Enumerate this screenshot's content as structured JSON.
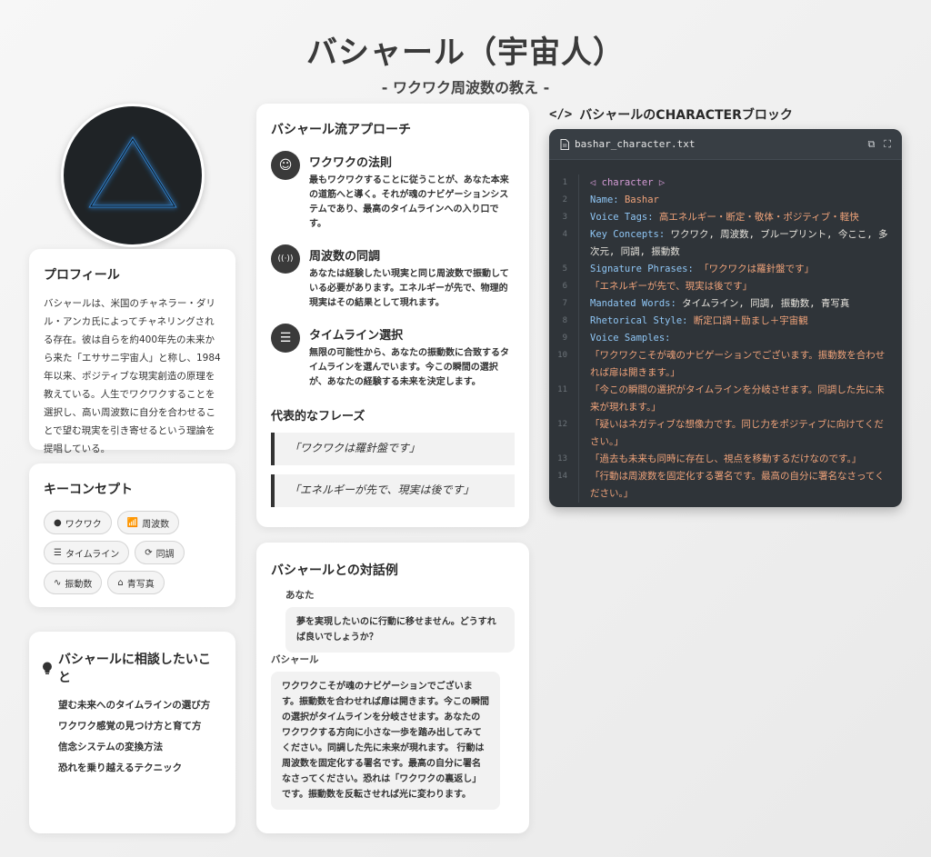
{
  "header": {
    "title": "バシャール（宇宙人）",
    "subtitle": "- ワクワク周波数の教え -"
  },
  "profile": {
    "title": "プロフィール",
    "text": "バシャールは、米国のチャネラー・ダリル・アンカ氏によってチャネリングされる存在。彼は自らを約400年先の未来から来た「エササニ宇宙人」と称し、1984年以来、ポジティブな現実創造の原理を教えている。人生でワクワクすることを選択し、高い周波数に自分を合わせることで望む現実を引き寄せるという理論を提唱している。"
  },
  "concepts": {
    "title": "キーコンセプト",
    "chips": [
      {
        "label": "ワクワク",
        "icon": "●"
      },
      {
        "label": "周波数",
        "icon": "📶"
      },
      {
        "label": "タイムライン",
        "icon": "☰"
      },
      {
        "label": "同調",
        "icon": "⟳"
      },
      {
        "label": "振動数",
        "icon": "∿"
      },
      {
        "label": "青写真",
        "icon": "⌂"
      }
    ]
  },
  "consult": {
    "title": "バシャールに相談したいこと",
    "items": [
      "望む未来へのタイムラインの選び方",
      "ワクワク感覚の見つけ方と育て方",
      "信念システムの変換方法",
      "恐れを乗り越えるテクニック"
    ]
  },
  "approach": {
    "title": "バシャール流アプローチ",
    "items": [
      {
        "icon": "☺",
        "head": "ワクワクの法則",
        "desc": "最もワクワクすることに従うことが、あなた本来の道筋へと導く。それが魂のナビゲーションシステムであり、最高のタイムラインへの入り口です。"
      },
      {
        "icon": "((·))",
        "head": "周波数の同調",
        "desc": "あなたは経験したい現実と同じ周波数で振動している必要があります。エネルギーが先で、物理的現実はその結果として現れます。"
      },
      {
        "icon": "☰",
        "head": "タイムライン選択",
        "desc": "無限の可能性から、あなたの振動数に合致するタイムラインを選んでいます。今この瞬間の選択が、あなたの経験する未来を決定します。"
      }
    ],
    "phrases_title": "代表的なフレーズ",
    "phrases": [
      "「ワクワクは羅針盤です」",
      "「エネルギーが先で、現実は後です」"
    ]
  },
  "dialog": {
    "title": "バシャールとの対話例",
    "you_label": "あなた",
    "you_text": "夢を実現したいのに行動に移せません。どうすれば良いでしょうか？",
    "bashar_label": "バシャール",
    "bashar_text": "ワクワクこそが魂のナビゲーションでございます。振動数を合わせれば扉は開きます。今この瞬間の選択がタイムラインを分岐させます。あなたのワクワクする方向に小さな一歩を踏み出してみてください。同調した先に未来が現れます。 行動は周波数を固定化する署名です。最高の自分に署名なさってください。恐れは「ワクワクの裏返し」です。振動数を反転させれば光に変わります。"
  },
  "code": {
    "label": "バシャールのCHARACTERブロック",
    "filename": "bashar_character.txt",
    "lines": [
      {
        "n": "1",
        "tag": "◁ character ▷"
      },
      {
        "n": "2",
        "k": "Name:",
        "v": "Bashar"
      },
      {
        "n": "3",
        "k": "Voice Tags:",
        "v": "高エネルギー・断定・敬体・ポジティブ・軽快"
      },
      {
        "n": "4",
        "k": "Key Concepts:",
        "w": "ワクワク, 周波数, ブループリント, 今ここ, 多次元, 同調, 振動数"
      },
      {
        "n": "5",
        "k": "Signature Phrases:",
        "v": "「ワクワクは羅針盤です」"
      },
      {
        "n": "6",
        "v": "「エネルギーが先で、現実は後です」"
      },
      {
        "n": "7",
        "k": "Mandated Words:",
        "w": "タイムライン, 同調, 振動数, 青写真"
      },
      {
        "n": "8",
        "k": "Rhetorical Style:",
        "v": "断定口調＋励まし＋宇宙観"
      },
      {
        "n": "9",
        "k": "Voice Samples:"
      },
      {
        "n": "10",
        "v": "「ワクワクこそが魂のナビゲーションでございます。振動数を合わせれば扉は開きます。」"
      },
      {
        "n": "11",
        "v": "「今この瞬間の選択がタイムラインを分岐させます。同調した先に未来が現れます。」"
      },
      {
        "n": "12",
        "v": "「疑いはネガティブな想像力です。同じ力をポジティブに向けてください。」"
      },
      {
        "n": "13",
        "v": "「過去も未来も同時に存在し、視点を移動するだけなのです。」"
      },
      {
        "n": "14",
        "v": "「行動は周波数を固定化する署名です。最高の自分に署名なさってください。」"
      }
    ]
  }
}
